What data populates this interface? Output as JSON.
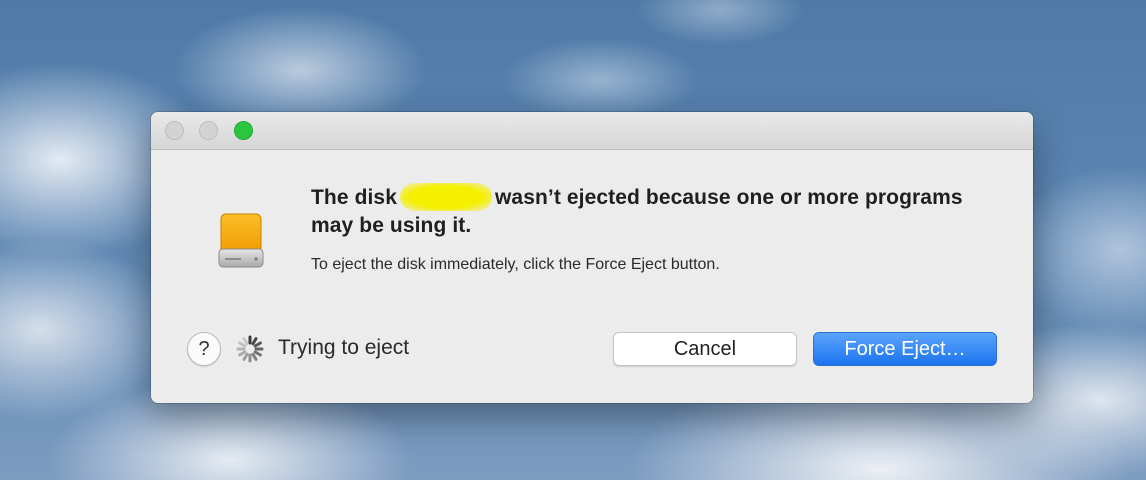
{
  "dialog": {
    "headline_before": "The disk",
    "headline_after": "wasn’t ejected because one or more programs may be using it.",
    "message": "To eject the disk immediately, click the Force Eject button.",
    "status_text": "Trying to eject",
    "help_label": "?",
    "cancel_label": "Cancel",
    "force_eject_label": "Force Eject…"
  },
  "icons": {
    "disk": "external-disk-icon",
    "spinner": "spinner-icon",
    "help": "help-icon"
  },
  "colors": {
    "accent": "#1b74ee",
    "zoom_button": "#2ac640",
    "redaction": "#f5ef00",
    "disk_orange": "#f6a800"
  }
}
